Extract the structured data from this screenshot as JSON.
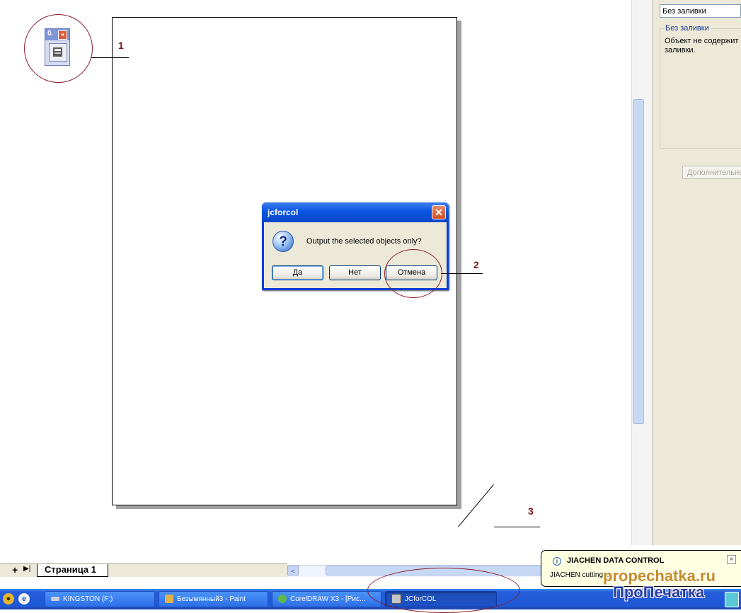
{
  "annotations": {
    "num1": "1",
    "num2": "2",
    "num3": "3"
  },
  "mini_toolbar": {
    "label": "0.",
    "close": "×"
  },
  "docker": {
    "fill_select_value": "Без заливки",
    "fill_group_title": "Без заливки",
    "fill_description": "Объект не содержит заливки.",
    "more_button": "Дополнительно"
  },
  "page_tabs": {
    "add_icon": "+",
    "last_icon": "▶|",
    "tab_label": "Страница 1"
  },
  "hscroll": {
    "left_arrow": "<"
  },
  "dialog": {
    "title": "jcforcol",
    "close": "✕",
    "icon": "?",
    "message": "Output the selected objects only?",
    "buttons": {
      "yes": "Да",
      "no": "Нет",
      "cancel": "Отмена"
    }
  },
  "balloon": {
    "icon": "i",
    "title": "JIACHEN DATA CONTROL",
    "text": "JIACHEN  cutting ...",
    "close": "×"
  },
  "taskbar": {
    "items": [
      {
        "label": "KINGSTON (F:)"
      },
      {
        "label": "Безымянный3 - Paint"
      },
      {
        "label": "CorelDRAW X3 - [Рис..."
      },
      {
        "label": "JCforCOL"
      }
    ]
  },
  "watermark": {
    "line1": "propechatka.ru",
    "line2": "ПроПечатка"
  },
  "colors": {
    "annotation": "#8b1d2a",
    "taskbar": "#245edb",
    "dialog_frame": "#0a3fd6",
    "balloon_bg": "#ffffe1"
  }
}
